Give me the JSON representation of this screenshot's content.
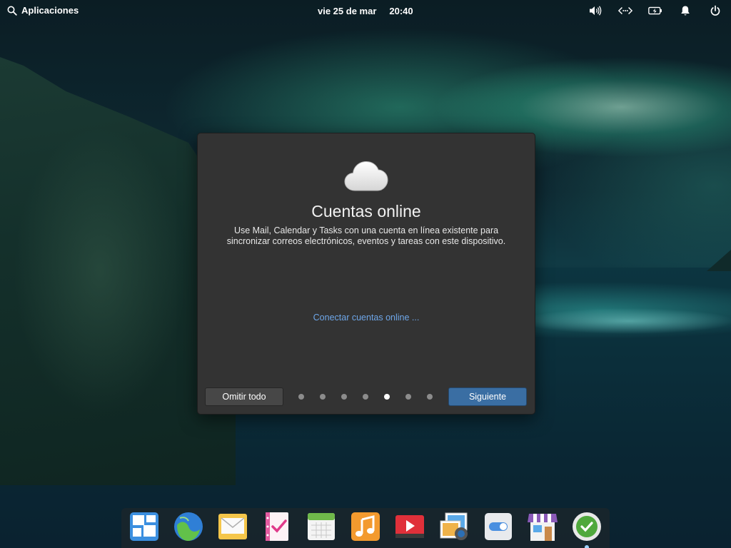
{
  "panel": {
    "applications_label": "Aplicaciones",
    "date": "vie 25 de mar",
    "time": "20:40",
    "indicators": [
      "volume-icon",
      "network-icon",
      "battery-icon",
      "notifications-icon",
      "power-icon"
    ]
  },
  "dialog": {
    "icon": "cloud-icon",
    "title": "Cuentas online",
    "description": "Use Mail, Calendar y Tasks con una cuenta en línea existente para sincronizar correos electrónicos, eventos y tareas con este dispositivo.",
    "link": "Conectar cuentas online ...",
    "skip_button": "Omitir todo",
    "next_button": "Siguiente",
    "pages": 7,
    "current_page": 5
  },
  "dock": {
    "items": [
      "multitasking-view-icon",
      "web-browser-icon",
      "mail-icon",
      "tasks-icon",
      "calendar-icon",
      "music-icon",
      "videos-icon",
      "photos-icon",
      "system-settings-icon",
      "appcenter-icon",
      "welcome-check-icon"
    ]
  },
  "colors": {
    "dialog_bg": "#333333",
    "accent": "#3a6ea3",
    "link": "#6ea6e8"
  }
}
